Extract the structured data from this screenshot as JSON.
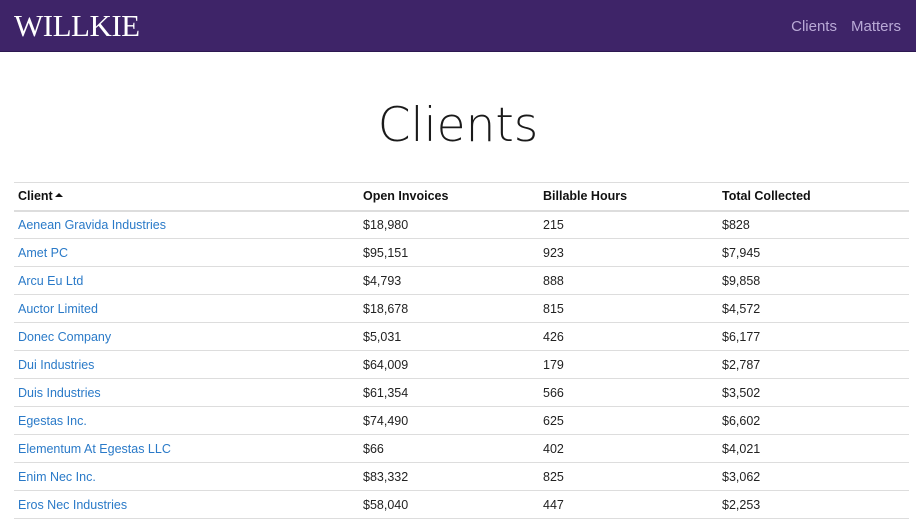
{
  "navbar": {
    "brand": "WILLKIE",
    "links": [
      {
        "label": "Clients"
      },
      {
        "label": "Matters"
      }
    ],
    "background": "#3e2468"
  },
  "page": {
    "title": "Clients"
  },
  "table": {
    "sort": {
      "column": "Client",
      "direction": "ascending",
      "icon": "caret-up-icon"
    },
    "headers": [
      "Client",
      "Open Invoices",
      "Billable Hours",
      "Total Collected"
    ],
    "rows": [
      {
        "client": "Aenean Gravida Industries",
        "open_invoices": "$18,980",
        "billable_hours": "215",
        "total_collected": "$828"
      },
      {
        "client": "Amet PC",
        "open_invoices": "$95,151",
        "billable_hours": "923",
        "total_collected": "$7,945"
      },
      {
        "client": "Arcu Eu Ltd",
        "open_invoices": "$4,793",
        "billable_hours": "888",
        "total_collected": "$9,858"
      },
      {
        "client": "Auctor Limited",
        "open_invoices": "$18,678",
        "billable_hours": "815",
        "total_collected": "$4,572"
      },
      {
        "client": "Donec Company",
        "open_invoices": "$5,031",
        "billable_hours": "426",
        "total_collected": "$6,177"
      },
      {
        "client": "Dui Industries",
        "open_invoices": "$64,009",
        "billable_hours": "179",
        "total_collected": "$2,787"
      },
      {
        "client": "Duis Industries",
        "open_invoices": "$61,354",
        "billable_hours": "566",
        "total_collected": "$3,502"
      },
      {
        "client": "Egestas Inc.",
        "open_invoices": "$74,490",
        "billable_hours": "625",
        "total_collected": "$6,602"
      },
      {
        "client": "Elementum At Egestas LLC",
        "open_invoices": "$66",
        "billable_hours": "402",
        "total_collected": "$4,021"
      },
      {
        "client": "Enim Nec Inc.",
        "open_invoices": "$83,332",
        "billable_hours": "825",
        "total_collected": "$3,062"
      },
      {
        "client": "Eros Nec Industries",
        "open_invoices": "$58,040",
        "billable_hours": "447",
        "total_collected": "$2,253"
      }
    ]
  }
}
